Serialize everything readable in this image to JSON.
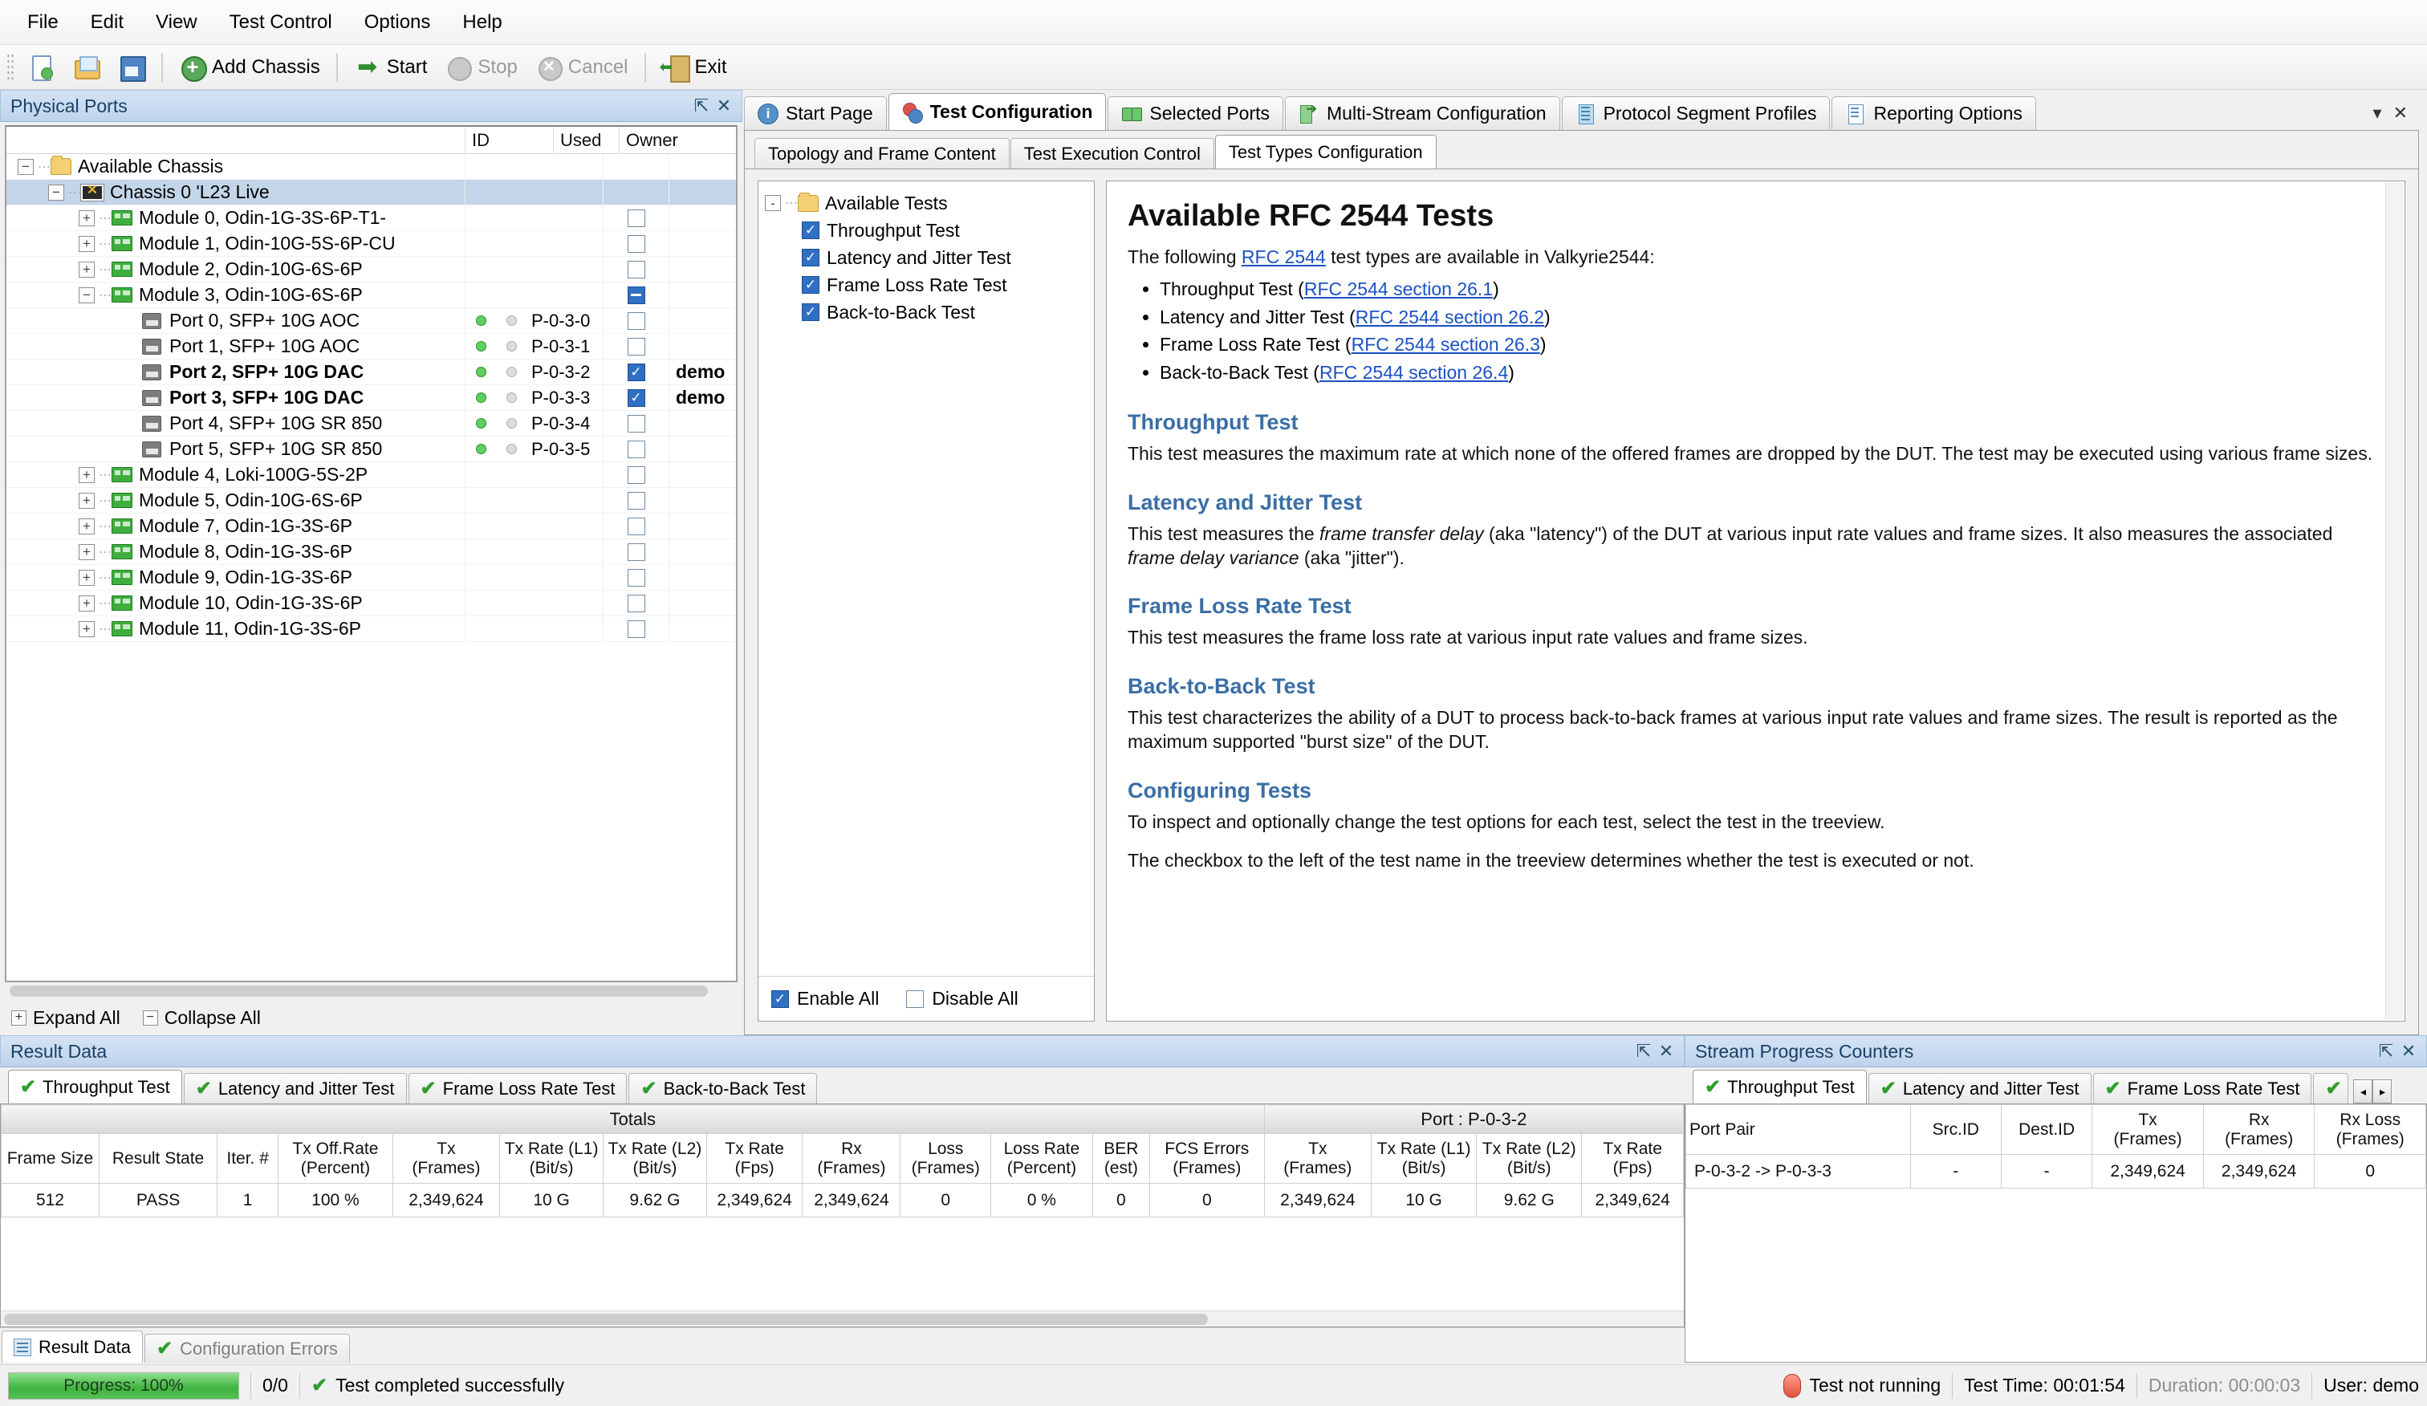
{
  "menu": {
    "items": [
      {
        "label": "File"
      },
      {
        "label": "Edit"
      },
      {
        "label": "View"
      },
      {
        "label": "Test Control"
      },
      {
        "label": "Options"
      },
      {
        "label": "Help"
      }
    ]
  },
  "toolbar": {
    "new_label": "",
    "open_label": "",
    "save_label": "",
    "add_chassis_label": "Add Chassis",
    "start_label": "Start",
    "stop_label": "Stop",
    "cancel_label": "Cancel",
    "exit_label": "Exit"
  },
  "physical_ports": {
    "title": "Physical Ports",
    "pin_icon": "pin-icon",
    "close_icon": "close-icon",
    "columns": [
      "",
      "ID",
      "Used",
      "Owner"
    ],
    "rows": [
      {
        "indent": 0,
        "expander": "-",
        "icon": "folder-icon",
        "label": "Available Chassis",
        "id": "",
        "used": "",
        "owner": "",
        "selected": false,
        "led": ""
      },
      {
        "indent": 1,
        "expander": "-",
        "icon": "chassis-icon",
        "label": "Chassis 0 'L23 Live",
        "id": "",
        "used": "",
        "owner": "",
        "selected": true,
        "led": ""
      },
      {
        "indent": 2,
        "expander": "+",
        "icon": "module-icon",
        "label": "Module 0, Odin-1G-3S-6P-T1-",
        "id": "",
        "used": "off",
        "owner": "",
        "selected": false,
        "led": ""
      },
      {
        "indent": 2,
        "expander": "+",
        "icon": "module-icon",
        "label": "Module 1, Odin-10G-5S-6P-CU",
        "id": "",
        "used": "off",
        "owner": "",
        "selected": false,
        "led": ""
      },
      {
        "indent": 2,
        "expander": "+",
        "icon": "module-icon",
        "label": "Module 2, Odin-10G-6S-6P",
        "id": "",
        "used": "off",
        "owner": "",
        "selected": false,
        "led": ""
      },
      {
        "indent": 2,
        "expander": "-",
        "icon": "module-icon",
        "label": "Module 3, Odin-10G-6S-6P",
        "id": "",
        "used": "dash",
        "owner": "",
        "selected": false,
        "led": ""
      },
      {
        "indent": 3,
        "expander": "",
        "icon": "port-icon",
        "label": "Port 0, SFP+ 10G AOC",
        "id": "P-0-3-0",
        "used": "off",
        "owner": "",
        "selected": false,
        "led": "green"
      },
      {
        "indent": 3,
        "expander": "",
        "icon": "port-icon",
        "label": "Port 1, SFP+ 10G AOC",
        "id": "P-0-3-1",
        "used": "off",
        "owner": "",
        "selected": false,
        "led": "green"
      },
      {
        "indent": 3,
        "expander": "",
        "icon": "port-icon",
        "label": "Port 2, SFP+ 10G DAC",
        "id": "P-0-3-2",
        "used": "on",
        "owner": "demo",
        "selected": false,
        "led": "green",
        "bold": true
      },
      {
        "indent": 3,
        "expander": "",
        "icon": "port-icon",
        "label": "Port 3, SFP+ 10G DAC",
        "id": "P-0-3-3",
        "used": "on",
        "owner": "demo",
        "selected": false,
        "led": "green",
        "bold": true
      },
      {
        "indent": 3,
        "expander": "",
        "icon": "port-icon",
        "label": "Port 4, SFP+ 10G SR 850",
        "id": "P-0-3-4",
        "used": "off",
        "owner": "",
        "selected": false,
        "led": "green"
      },
      {
        "indent": 3,
        "expander": "",
        "icon": "port-icon",
        "label": "Port 5, SFP+ 10G SR 850",
        "id": "P-0-3-5",
        "used": "off",
        "owner": "",
        "selected": false,
        "led": "green"
      },
      {
        "indent": 2,
        "expander": "+",
        "icon": "module-icon",
        "label": "Module 4, Loki-100G-5S-2P",
        "id": "",
        "used": "off",
        "owner": "",
        "selected": false,
        "led": ""
      },
      {
        "indent": 2,
        "expander": "+",
        "icon": "module-icon",
        "label": "Module 5, Odin-10G-6S-6P",
        "id": "",
        "used": "off",
        "owner": "",
        "selected": false,
        "led": ""
      },
      {
        "indent": 2,
        "expander": "+",
        "icon": "module-icon",
        "label": "Module 7, Odin-1G-3S-6P",
        "id": "",
        "used": "off",
        "owner": "",
        "selected": false,
        "led": ""
      },
      {
        "indent": 2,
        "expander": "+",
        "icon": "module-icon",
        "label": "Module 8, Odin-1G-3S-6P",
        "id": "",
        "used": "off",
        "owner": "",
        "selected": false,
        "led": ""
      },
      {
        "indent": 2,
        "expander": "+",
        "icon": "module-icon",
        "label": "Module 9, Odin-1G-3S-6P",
        "id": "",
        "used": "off",
        "owner": "",
        "selected": false,
        "led": ""
      },
      {
        "indent": 2,
        "expander": "+",
        "icon": "module-icon",
        "label": "Module 10, Odin-1G-3S-6P",
        "id": "",
        "used": "off",
        "owner": "",
        "selected": false,
        "led": ""
      },
      {
        "indent": 2,
        "expander": "+",
        "icon": "module-icon",
        "label": "Module 11, Odin-1G-3S-6P",
        "id": "",
        "used": "off",
        "owner": "",
        "selected": false,
        "led": ""
      }
    ],
    "expand_all": "Expand All",
    "collapse_all": "Collapse All"
  },
  "main_tabs": [
    {
      "label": "Start Page",
      "icon": "info-icon",
      "active": false
    },
    {
      "label": "Test Configuration",
      "icon": "configuration-icon",
      "active": true
    },
    {
      "label": "Selected Ports",
      "icon": "ports-icon",
      "active": false
    },
    {
      "label": "Multi-Stream Configuration",
      "icon": "stream-icon",
      "active": false
    },
    {
      "label": "Protocol Segment Profiles",
      "icon": "protocol-icon",
      "active": false
    },
    {
      "label": "Reporting Options",
      "icon": "report-icon",
      "active": false
    }
  ],
  "sub_tabs": [
    {
      "label": "Topology and Frame Content",
      "active": false
    },
    {
      "label": "Test Execution Control",
      "active": false
    },
    {
      "label": "Test Types Configuration",
      "active": true
    }
  ],
  "test_tree": {
    "root": {
      "label": "Available Tests",
      "expander": "-"
    },
    "items": [
      {
        "label": "Throughput Test",
        "checked": true
      },
      {
        "label": "Latency and Jitter Test",
        "checked": true
      },
      {
        "label": "Frame Loss Rate Test",
        "checked": true
      },
      {
        "label": "Back-to-Back Test",
        "checked": true
      }
    ],
    "enable_all": "Enable All",
    "disable_all": "Disable All",
    "enable_all_checked": true,
    "disable_all_checked": false
  },
  "doc": {
    "title": "Available RFC 2544 Tests",
    "intro_prefix": "The following ",
    "intro_link": "RFC 2544",
    "intro_suffix": " test types are available in Valkyrie2544:",
    "bullets": [
      {
        "name": "Throughput Test",
        "link": "RFC 2544 section 26.1"
      },
      {
        "name": "Latency and Jitter Test",
        "link": "RFC 2544 section 26.2"
      },
      {
        "name": "Frame Loss Rate Test",
        "link": "RFC 2544 section 26.3"
      },
      {
        "name": "Back-to-Back Test",
        "link": "RFC 2544 section 26.4"
      }
    ],
    "sections": [
      {
        "heading": "Throughput Test",
        "body": "This test measures the maximum rate at which none of the offered frames are dropped by the DUT. The test may be executed using various frame sizes."
      },
      {
        "heading": "Latency and Jitter Test",
        "body_1": "This test measures the ",
        "italic_1": "frame transfer delay",
        "body_2": " (aka \"latency\") of the DUT at various input rate values and frame sizes. It also measures the associated ",
        "italic_2": "frame delay variance",
        "body_3": " (aka \"jitter\")."
      },
      {
        "heading": "Frame Loss Rate Test",
        "body": "This test measures the frame loss rate at various input rate values and frame sizes."
      },
      {
        "heading": "Back-to-Back Test",
        "body": "This test characterizes the ability of a DUT to process back-to-back frames at various input rate values and frame sizes. The result is reported as the maximum supported \"burst size\" of the DUT."
      },
      {
        "heading": "Configuring Tests",
        "body": "To inspect and optionally change the test options for each test, select the test in the treeview.",
        "body2": "The checkbox to the left of the test name in the treeview determines whether the test is executed or not."
      }
    ]
  },
  "result_data": {
    "title": "Result Data",
    "pin_icon": "pin-icon",
    "close_icon": "close-icon",
    "tabs": [
      {
        "label": "Throughput Test",
        "active": true
      },
      {
        "label": "Latency and Jitter Test",
        "active": false
      },
      {
        "label": "Frame Loss Rate Test",
        "active": false
      },
      {
        "label": "Back-to-Back Test",
        "active": false
      }
    ],
    "group_headers": [
      {
        "label": "Totals",
        "span": 13
      },
      {
        "label": "Port : P-0-3-2",
        "span": 4
      }
    ],
    "columns": [
      "Frame Size",
      "Result State",
      "Iter. #",
      "Tx Off.Rate\n(Percent)",
      "Tx\n(Frames)",
      "Tx Rate (L1)\n(Bit/s)",
      "Tx Rate (L2)\n(Bit/s)",
      "Tx Rate\n(Fps)",
      "Rx\n(Frames)",
      "Loss\n(Frames)",
      "Loss Rate\n(Percent)",
      "BER\n(est)",
      "FCS Errors\n(Frames)",
      "Tx\n(Frames)",
      "Tx Rate (L1)\n(Bit/s)",
      "Tx Rate (L2)\n(Bit/s)",
      "Tx Rate\n(Fps)"
    ],
    "rows": [
      [
        "512",
        "PASS",
        "1",
        "100 %",
        "2,349,624",
        "10 G",
        "9.62 G",
        "2,349,624",
        "2,349,624",
        "0",
        "0 %",
        "0",
        "0",
        "2,349,624",
        "10 G",
        "9.62 G",
        "2,349,624"
      ]
    ],
    "lower_tabs": [
      {
        "label": "Result Data",
        "active": true,
        "icon": "result-data-icon"
      },
      {
        "label": "Configuration Errors",
        "active": false,
        "icon": "check-icon"
      }
    ]
  },
  "stream_progress": {
    "title": "Stream Progress Counters",
    "pin_icon": "pin-icon",
    "close_icon": "close-icon",
    "tabs": [
      {
        "label": "Throughput Test",
        "active": true
      },
      {
        "label": "Latency and Jitter Test",
        "active": false
      },
      {
        "label": "Frame Loss Rate Test",
        "active": false
      }
    ],
    "nav_prev": "◂",
    "nav_next": "▸",
    "columns": [
      "Port Pair",
      "Src.ID",
      "Dest.ID",
      "Tx\n(Frames)",
      "Rx\n(Frames)",
      "Rx Loss\n(Frames)"
    ],
    "rows": [
      [
        "P-0-3-2 -> P-0-3-3",
        "-",
        "-",
        "2,349,624",
        "2,349,624",
        "0"
      ]
    ]
  },
  "status_bar": {
    "progress_label": "Progress: 100%",
    "progress_value": 100,
    "counter": "0/0",
    "message": "Test completed successfully",
    "running_state": "Test not running",
    "test_time": "Test Time: 00:01:54",
    "duration": "Duration: 00:00:03",
    "user": "User: demo"
  },
  "colors": {
    "accent": "#3a6ea5",
    "link": "#1b51c4",
    "pass": "#1b51c4",
    "progress_green": "#3fb23f",
    "selection": "#c3d5e8"
  }
}
